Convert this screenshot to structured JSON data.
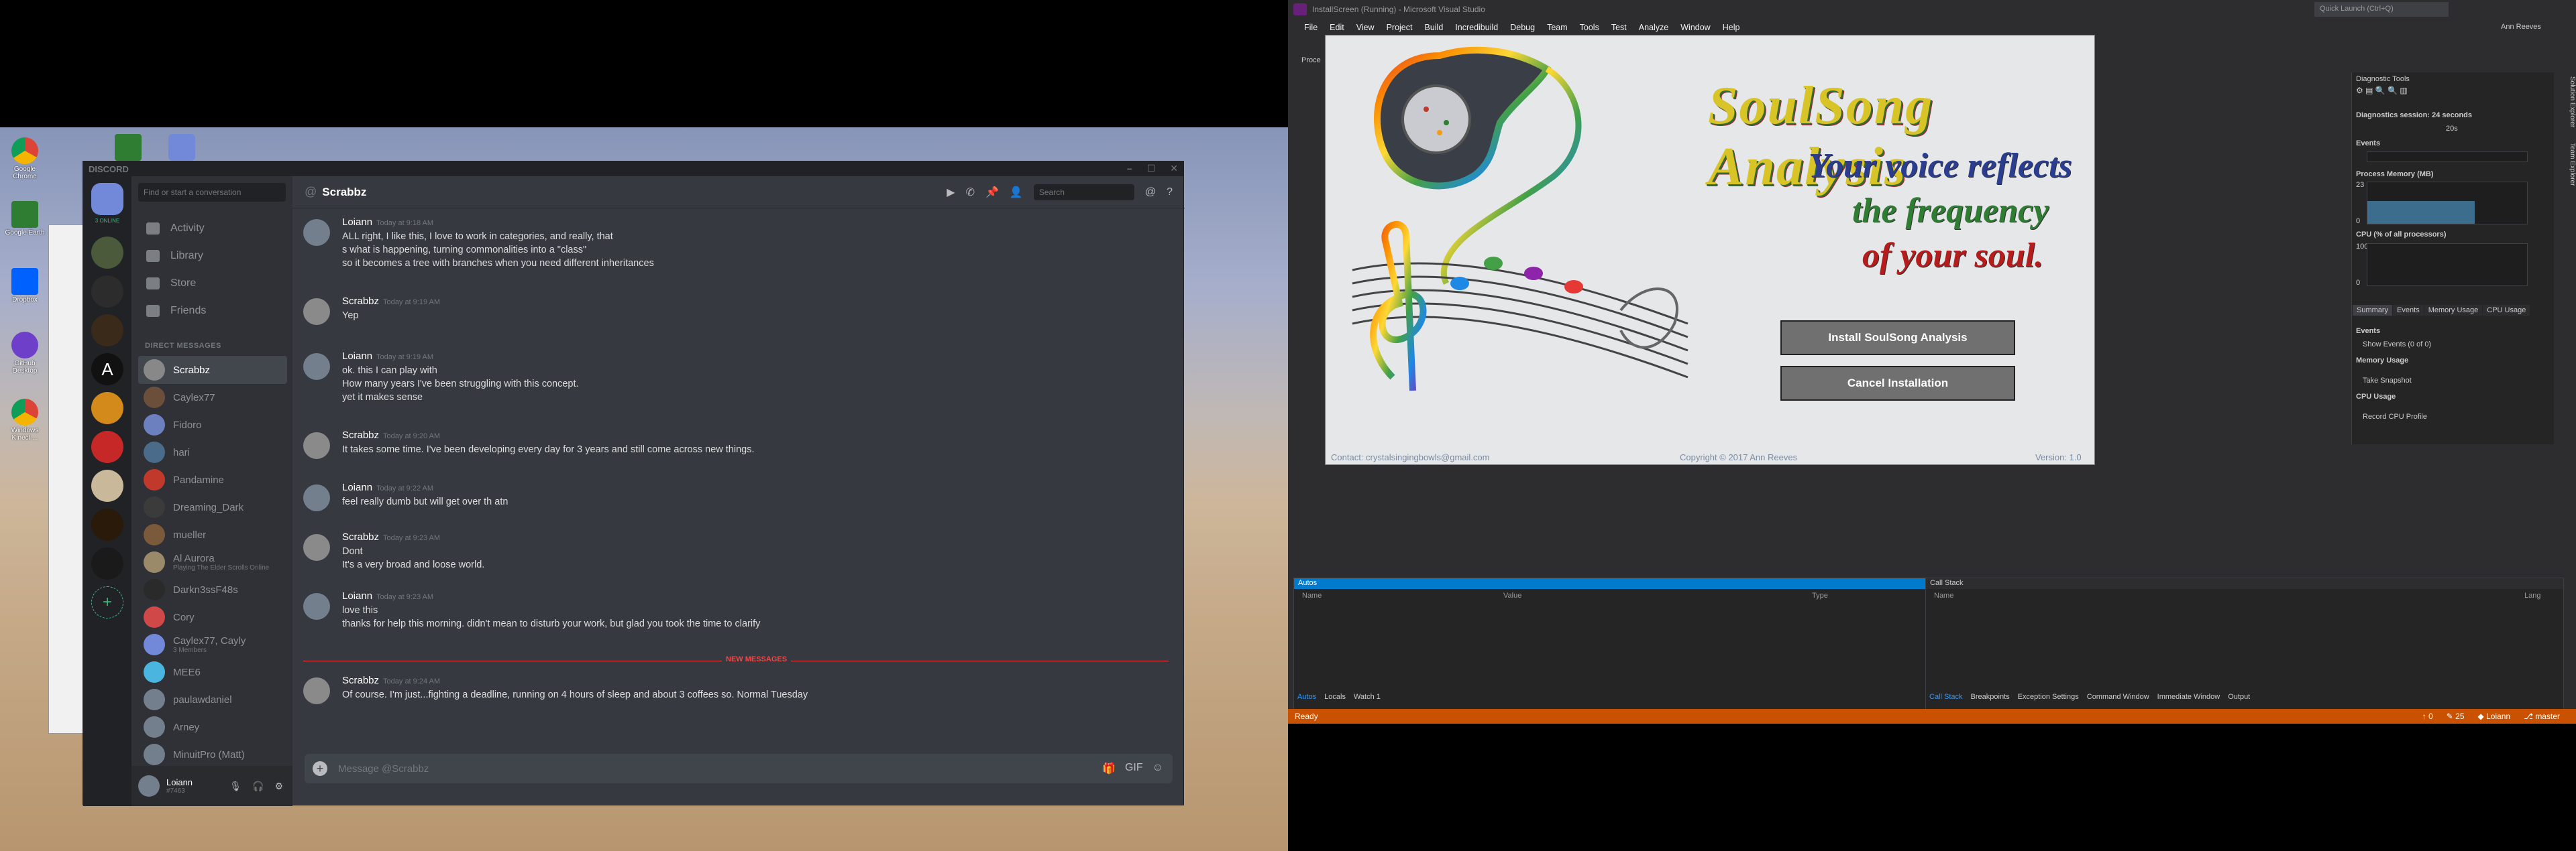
{
  "discord": {
    "title": "DISCORD",
    "search_placeholder": "Find or start a conversation",
    "online_count": "3 ONLINE",
    "nav": [
      "Activity",
      "Library",
      "Store",
      "Friends"
    ],
    "dm_header": "DIRECT MESSAGES",
    "dms": [
      {
        "name": "Scrabbz",
        "sub": "",
        "color": "#888"
      },
      {
        "name": "Caylex77",
        "sub": "",
        "color": "#6b4f3a"
      },
      {
        "name": "Fidoro",
        "sub": "",
        "color": "#6c7fbf"
      },
      {
        "name": "hari",
        "sub": "",
        "color": "#4a6b8a"
      },
      {
        "name": "Pandamine",
        "sub": "",
        "color": "#c0392b"
      },
      {
        "name": "Dreaming_Dark",
        "sub": "",
        "color": "#3b3b3b"
      },
      {
        "name": "mueller",
        "sub": "",
        "color": "#7a5a3a"
      },
      {
        "name": "Al Aurora",
        "sub": "Playing The Elder Scrolls Online",
        "color": "#9a8a6a"
      },
      {
        "name": "Darkn3ssF48s",
        "sub": "",
        "color": "#2a2a2a"
      },
      {
        "name": "Cory",
        "sub": "",
        "color": "#d04848"
      },
      {
        "name": "Caylex77, Cayly",
        "sub": "3 Members",
        "color": "#7289da"
      },
      {
        "name": "MEE6",
        "sub": "",
        "color": "#4ab6e0"
      },
      {
        "name": "paulawdaniel",
        "sub": "",
        "color": "#747f8d"
      },
      {
        "name": "Arney",
        "sub": "",
        "color": "#747f8d"
      },
      {
        "name": "MinuitPro (Matt)",
        "sub": "",
        "color": "#747f8d"
      }
    ],
    "user": {
      "name": "Loiann",
      "tag": "#7463"
    },
    "channel": "Scrabbz",
    "search_label": "Search",
    "new_messages": "NEW MESSAGES",
    "input_placeholder": "Message @Scrabbz",
    "messages": [
      {
        "author": "Loiann",
        "time": "Today at 9:18 AM",
        "lines": [
          "ALL right, I like this, I love to work in categories, and really, that",
          "s what is happening, turning commonalities into a \"class\"",
          "so it becomes a tree with branches when you  need different inheritances"
        ]
      },
      {
        "author": "Scrabbz",
        "time": "Today at 9:19 AM",
        "lines": [
          "Yep"
        ]
      },
      {
        "author": "Loiann",
        "time": "Today at 9:19 AM",
        "lines": [
          "ok. this I can play with",
          "How many years I've been struggling with this concept.",
          "yet it makes sense"
        ]
      },
      {
        "author": "Scrabbz",
        "time": "Today at 9:20 AM",
        "lines": [
          "It takes some time. I've been developing every day for 3 years and still come across new things."
        ]
      },
      {
        "author": "Loiann",
        "time": "Today at 9:22 AM",
        "lines": [
          "feel really dumb but will get over th atn"
        ]
      },
      {
        "author": "Scrabbz",
        "time": "Today at 9:23 AM",
        "lines": [
          "Dont",
          "It's a very broad and loose world."
        ]
      },
      {
        "author": "Loiann",
        "time": "Today at 9:23 AM",
        "lines": [
          "love this",
          "thanks for help this morning. didn't mean to disturb your work, but glad you took the time to clarify"
        ]
      },
      {
        "author": "Scrabbz",
        "time": "Today at 9:24 AM",
        "lines": [
          "Of course. I'm just...fighting a deadline, running on 4 hours of sleep and about 3 coffees so. Normal Tuesday"
        ]
      }
    ]
  },
  "desktop": {
    "icons": [
      "Google Chrome",
      "Google Earth",
      "Dropbox",
      "GitHub Desktop",
      "Windows Kinect ..."
    ]
  },
  "vs": {
    "title": "InstallScreen (Running) - Microsoft Visual Studio",
    "quick_launch": "Quick Launch (Ctrl+Q)",
    "user": "Ann Reeves",
    "menu": [
      "File",
      "Edit",
      "View",
      "Project",
      "Build",
      "Incredibuild",
      "Debug",
      "Team",
      "Tools",
      "Test",
      "Analyze",
      "Window",
      "Help"
    ],
    "process_label": "Proce",
    "installer": {
      "title": "SoulSong Analysis",
      "tagline": [
        "Your voice reflects",
        "the frequency",
        "of your soul."
      ],
      "install_button": "Install SoulSong Analysis",
      "cancel_button": "Cancel Installation",
      "contact": "Contact: crystalsingingbowls@gmail.com",
      "copyright": "Copyright © 2017 Ann Reeves",
      "version": "Version: 1.0"
    },
    "diag": {
      "title": "Diagnostic Tools",
      "session": "Diagnostics session: 24 seconds",
      "time_tick": "20s",
      "events": "Events",
      "memory": "Process Memory (MB)",
      "mem_max": "23",
      "mem_min": "0",
      "mem_level": 0.55,
      "cpu": "CPU (% of all processors)",
      "cpu_max": "100",
      "cpu_min": "0",
      "tabs": [
        "Summary",
        "Events",
        "Memory Usage",
        "CPU Usage"
      ],
      "events_hdr": "Events",
      "show_events": "Show Events (0 of 0)",
      "mem_hdr": "Memory Usage",
      "snapshot": "Take Snapshot",
      "cpu_hdr": "CPU Usage",
      "cpu_profile": "Record CPU Profile"
    },
    "side_labels": [
      "Solution Explorer",
      "Team Explorer"
    ],
    "autos": {
      "title": "Autos",
      "cols": [
        "Name",
        "Value",
        "Type"
      ],
      "tabs": [
        "Autos",
        "Locals",
        "Watch 1"
      ]
    },
    "callstack": {
      "title": "Call Stack",
      "cols": [
        "Name",
        "Lang"
      ],
      "tabs": [
        "Call Stack",
        "Breakpoints",
        "Exception Settings",
        "Command Window",
        "Immediate Window",
        "Output"
      ]
    },
    "status": {
      "text": "Ready",
      "up": "0",
      "pencil": "25",
      "repo": "Loiann",
      "branch": "master"
    }
  }
}
